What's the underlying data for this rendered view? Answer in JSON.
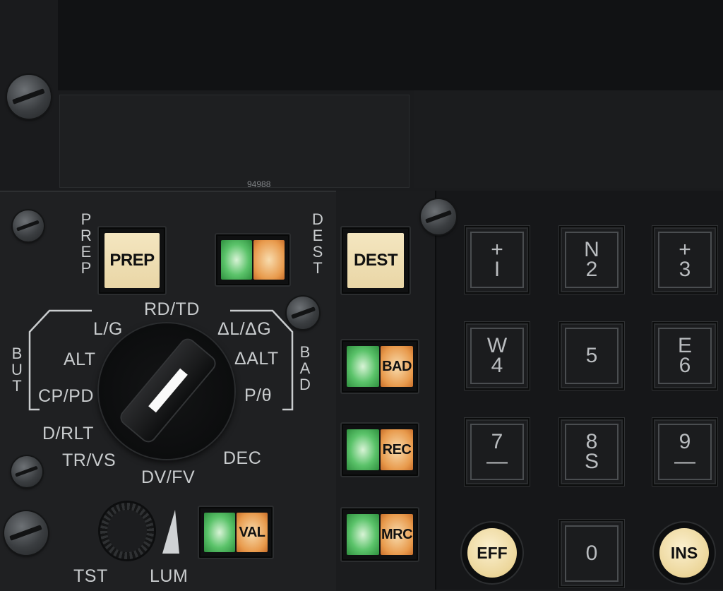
{
  "panel_number": "94988",
  "side_labels": {
    "prep": "PREP",
    "dest": "DEST",
    "but": "BUT",
    "bad": "BAD"
  },
  "buttons": {
    "prep": "PREP",
    "dest": "DEST",
    "bad": "BAD",
    "rec": "REC",
    "mrc": "MRC",
    "val": "VAL"
  },
  "selector": {
    "positions": [
      "RD/TD",
      "L/G",
      "ALT",
      "CP/PD",
      "D/RLT",
      "TR/VS",
      "DV/FV",
      "DEC",
      "P/θ",
      "ΔALT",
      "ΔL/ΔG"
    ],
    "knob_labels": {
      "tst": "TST",
      "lum": "LUM"
    }
  },
  "keypad": [
    {
      "top": "+",
      "bottom": "I"
    },
    {
      "top": "N",
      "bottom": "2"
    },
    {
      "top": "+",
      "bottom": "3"
    },
    {
      "top": "W",
      "bottom": "4"
    },
    {
      "top": "",
      "bottom": "5"
    },
    {
      "top": "E",
      "bottom": "6"
    },
    {
      "top": "7",
      "bottom": "—"
    },
    {
      "top": "8",
      "bottom": "S"
    },
    {
      "top": "9",
      "bottom": "—"
    },
    {
      "top": "",
      "bottom": "0"
    }
  ],
  "round_buttons": {
    "eff": "EFF",
    "ins": "INS"
  }
}
